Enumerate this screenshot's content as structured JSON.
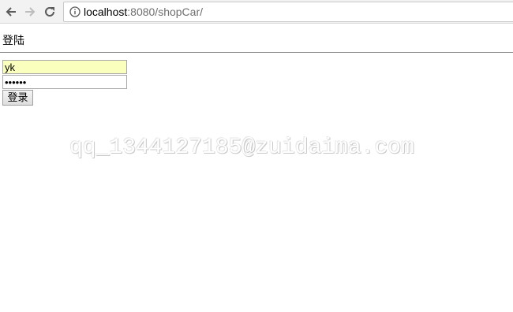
{
  "browser": {
    "url_host": "localhost",
    "url_path": ":8080/shopCar/",
    "icons": {
      "back": "arrow-left-icon",
      "forward": "arrow-right-icon",
      "reload": "reload-icon",
      "site_info": "info-circle-icon"
    }
  },
  "page": {
    "heading": "登陆",
    "login_form": {
      "username_value": "yk",
      "password_value": "••••••",
      "submit_label": "登录"
    },
    "watermark": "qq_1344127185@zuidaima.com"
  },
  "colors": {
    "autofill_background": "#faffbd",
    "toolbar_background": "#f2f2f2",
    "url_path": "#6f6f6f"
  }
}
